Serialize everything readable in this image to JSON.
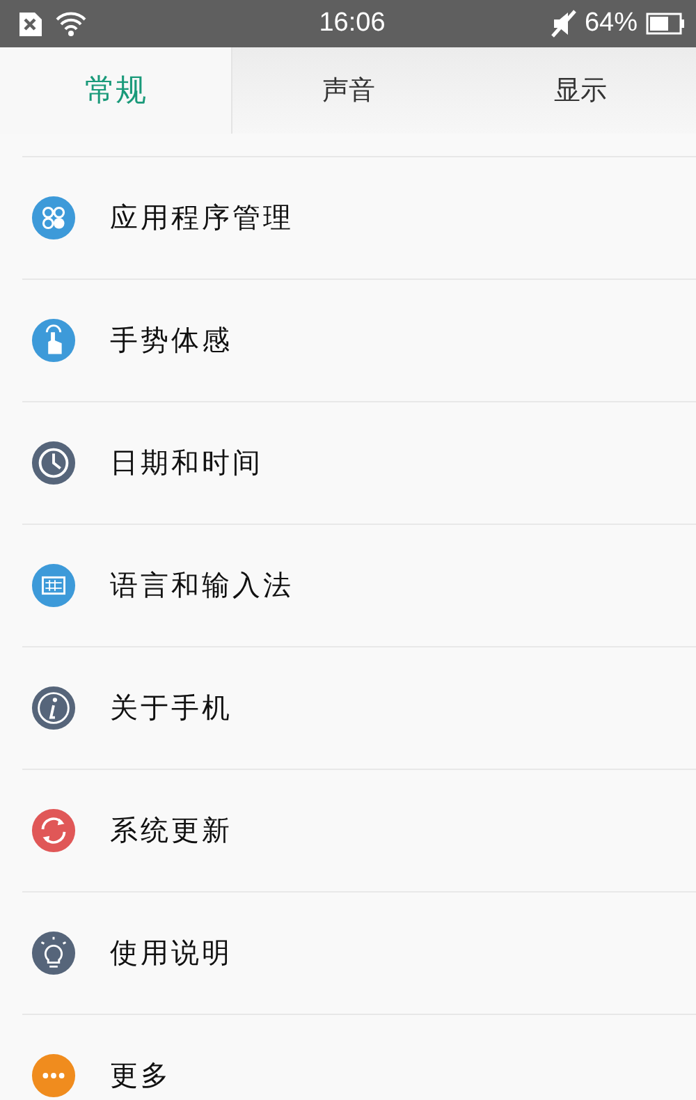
{
  "status_bar": {
    "time": "16:06",
    "battery": "64%"
  },
  "tabs": [
    {
      "label": "常规",
      "selected": true
    },
    {
      "label": "声音",
      "selected": false
    },
    {
      "label": "显示",
      "selected": false
    }
  ],
  "items": [
    {
      "label": "应用程序管理",
      "kind": "apps",
      "color": "#3d9ad9"
    },
    {
      "label": "手势体感",
      "kind": "gesture",
      "color": "#3d9ad9"
    },
    {
      "label": "日期和时间",
      "kind": "clock",
      "color": "#56657a"
    },
    {
      "label": "语言和输入法",
      "kind": "keyboard",
      "color": "#3d9ad9"
    },
    {
      "label": "关于手机",
      "kind": "info",
      "color": "#56657a"
    },
    {
      "label": "系统更新",
      "kind": "refresh",
      "color": "#e05757"
    },
    {
      "label": "使用说明",
      "kind": "bulb",
      "color": "#56657a"
    },
    {
      "label": "更多",
      "kind": "more",
      "color": "#f08c1e"
    }
  ]
}
